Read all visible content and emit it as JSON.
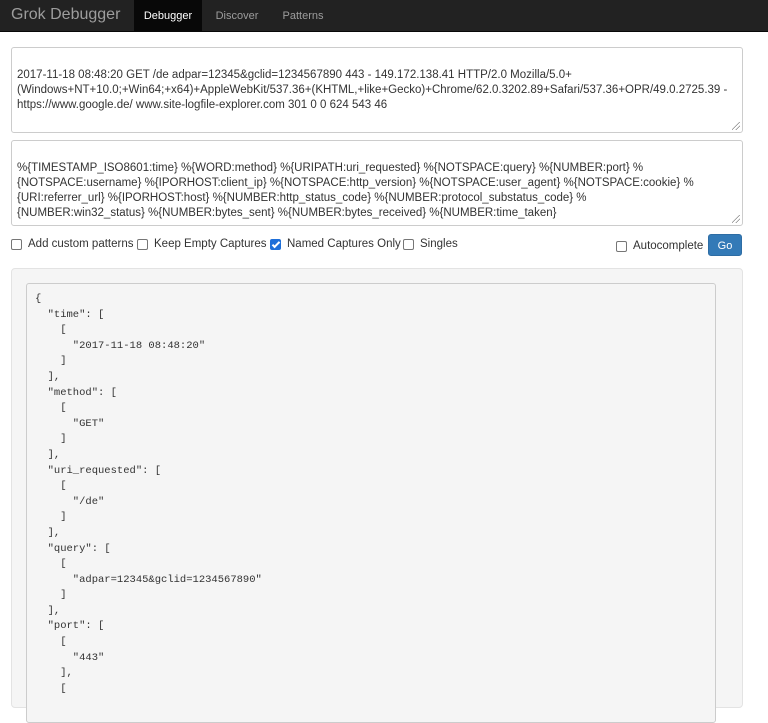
{
  "navbar": {
    "brand": "Grok Debugger",
    "tabs": [
      {
        "label": "Debugger",
        "active": true
      },
      {
        "label": "Discover",
        "active": false
      },
      {
        "label": "Patterns",
        "active": false
      }
    ]
  },
  "input": {
    "sample": "2017-11-18 08:48:20 GET /de adpar=12345&gclid=1234567890 443 - 149.172.138.41 HTTP/2.0 Mozilla/5.0+\n(Windows+NT+10.0;+Win64;+x64)+AppleWebKit/537.36+(KHTML,+like+Gecko)+Chrome/62.0.3202.89+Safari/537.36+OPR/49.0.2725.39 -\nhttps://www.google.de/ www.site-logfile-explorer.com 301 0 0 624 543 46",
    "pattern": "%{TIMESTAMP_ISO8601:time} %{WORD:method} %{URIPATH:uri_requested} %{NOTSPACE:query} %{NUMBER:port} %\n{NOTSPACE:username} %{IPORHOST:client_ip} %{NOTSPACE:http_version} %{NOTSPACE:user_agent} %{NOTSPACE:cookie} %\n{URI:referrer_url} %{IPORHOST:host} %{NUMBER:http_status_code} %{NUMBER:protocol_substatus_code} %\n{NUMBER:win32_status} %{NUMBER:bytes_sent} %{NUMBER:bytes_received} %{NUMBER:time_taken}"
  },
  "options": {
    "add_custom_patterns": {
      "label": "Add custom patterns",
      "checked": false
    },
    "keep_empty_captures": {
      "label": "Keep Empty Captures",
      "checked": false
    },
    "named_captures_only": {
      "label": "Named Captures Only",
      "checked": true
    },
    "singles": {
      "label": "Singles",
      "checked": false
    },
    "autocomplete": {
      "label": "Autocomplete",
      "checked": false
    }
  },
  "go_button": "Go",
  "output": "{\n  \"time\": [\n    [\n      \"2017-11-18 08:48:20\"\n    ]\n  ],\n  \"method\": [\n    [\n      \"GET\"\n    ]\n  ],\n  \"uri_requested\": [\n    [\n      \"/de\"\n    ]\n  ],\n  \"query\": [\n    [\n      \"adpar=12345&gclid=1234567890\"\n    ]\n  ],\n  \"port\": [\n    [\n      \"443\"\n    ],\n    ["
}
